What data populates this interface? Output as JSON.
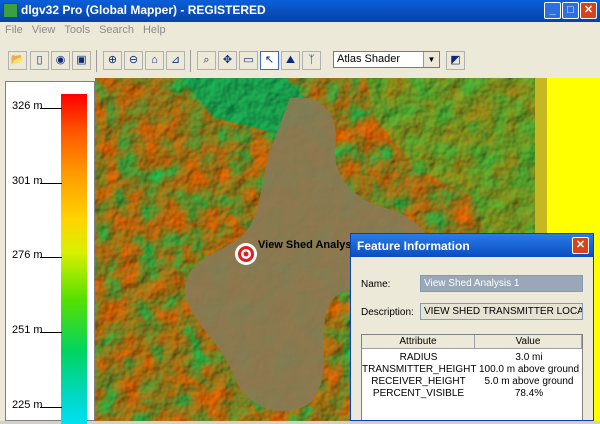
{
  "window": {
    "title": "dlgv32 Pro (Global Mapper) - REGISTERED"
  },
  "menu": [
    "File",
    "View",
    "Tools",
    "Search",
    "Help"
  ],
  "toolbar": {
    "shader": "Atlas Shader"
  },
  "legend": {
    "labels": [
      "326 m",
      "301 m",
      "276 m",
      "251 m",
      "225 m"
    ]
  },
  "map": {
    "feature_label": "View Shed Analysis",
    "colors": {
      "high": "#ff2a00",
      "low": "#00c060",
      "viewshed": "#8a7a55",
      "outside": "#ffff00"
    }
  },
  "dialog": {
    "title": "Feature Information",
    "name_label": "Name:",
    "name_value": "View Shed Analysis 1",
    "desc_label": "Description:",
    "desc_value": "VIEW SHED TRANSMITTER LOCATION",
    "columns": [
      "Attribute",
      "Value"
    ],
    "rows": [
      {
        "attr": "RADIUS",
        "value": "3.0 mi"
      },
      {
        "attr": "TRANSMITTER_HEIGHT",
        "value": "100.0 m above ground"
      },
      {
        "attr": "RECEIVER_HEIGHT",
        "value": "5.0 m above ground"
      },
      {
        "attr": "PERCENT_VISIBLE",
        "value": "78.4%"
      }
    ]
  }
}
